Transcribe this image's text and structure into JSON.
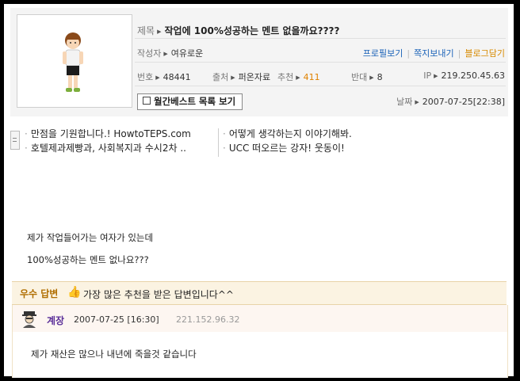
{
  "post": {
    "title_label": "제목",
    "title": "작업에 100%성공하는 멘트 없을까요????",
    "author_label": "작성자",
    "author": "여유로운",
    "links": [
      "프로필보기",
      "쪽지보내기",
      "블로그담기"
    ],
    "num_label": "번호",
    "num": "48441",
    "source_label": "출처",
    "source": "퍼온자료",
    "recommend_label": "추천",
    "recommend": "411",
    "oppose_label": "반대",
    "oppose": "8",
    "ip_label": "IP",
    "ip": "219.250.45.63",
    "best_button": "월간베스트 목록 보기",
    "date_label": "날짜",
    "date": "2007-07-25[22:38]"
  },
  "related": {
    "left": [
      "만점을 기원합니다.! HowtoTEPS.com",
      "호텔제과제빵과, 사회복지과 수시2차 .."
    ],
    "right": [
      "어떻게 생각하는지 이야기해봐.",
      "UCC 떠오르는 강자! 웃동이!"
    ]
  },
  "body": {
    "line1": "제가 작업들어가는 여자가 있는데",
    "line2": "100%성공하는 멘트 없나요???"
  },
  "best_answer": {
    "tag": "우수 답변",
    "message": "가장 많은 추천을 받은 답변입니다^^",
    "thumb_icon": "thumbs-up-icon",
    "name": "계장",
    "date": "2007-07-25 [16:30]",
    "ip": "221.152.96.32",
    "text": "제가 재산은 많으나 내년에 죽을것 같습니다"
  },
  "colors": {
    "link": "#1a62b8",
    "orange": "#e08200",
    "best_bar_bg": "#fbf3e2",
    "answer_name": "#5a2e98"
  }
}
